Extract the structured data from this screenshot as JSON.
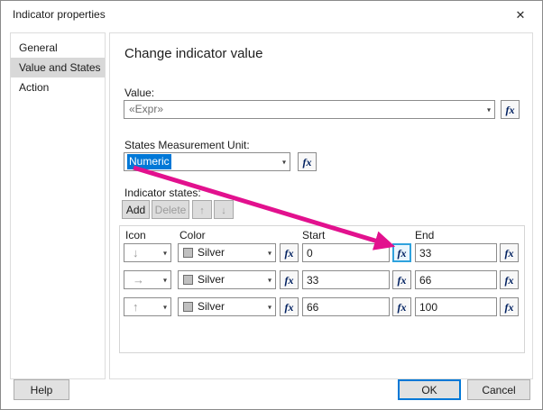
{
  "window": {
    "title": "Indicator properties"
  },
  "sidebar": {
    "items": [
      {
        "label": "General",
        "selected": false
      },
      {
        "label": "Value and States",
        "selected": true
      },
      {
        "label": "Action",
        "selected": false
      }
    ]
  },
  "main": {
    "heading": "Change indicator value",
    "value": {
      "label": "Value:",
      "text": "«Expr»"
    },
    "unit": {
      "label": "States Measurement Unit:",
      "text": "Numeric"
    },
    "states": {
      "label": "Indicator states:",
      "add_label": "Add",
      "delete_label": "Delete",
      "table": {
        "headers": {
          "icon": "Icon",
          "color": "Color",
          "start": "Start",
          "end": "End"
        },
        "rows": [
          {
            "icon": "↓",
            "color": "Silver",
            "start": "0",
            "end": "33"
          },
          {
            "icon": "→",
            "color": "Silver",
            "start": "33",
            "end": "66"
          },
          {
            "icon": "↑",
            "color": "Silver",
            "start": "66",
            "end": "100"
          }
        ]
      }
    }
  },
  "footer": {
    "help": "Help",
    "ok": "OK",
    "cancel": "Cancel"
  },
  "glyphs": {
    "close": "✕",
    "caret": "▾",
    "fx": "fx",
    "up_arrow": "↑",
    "down_arrow": "↓"
  },
  "colors": {
    "selection_blue": "#0078d7",
    "annotation_pink": "#e2118e",
    "silver_swatch": "#c0c0c0",
    "focus_highlight": "#2fa2dd",
    "sidebar_selected": "#d8d8d8"
  }
}
